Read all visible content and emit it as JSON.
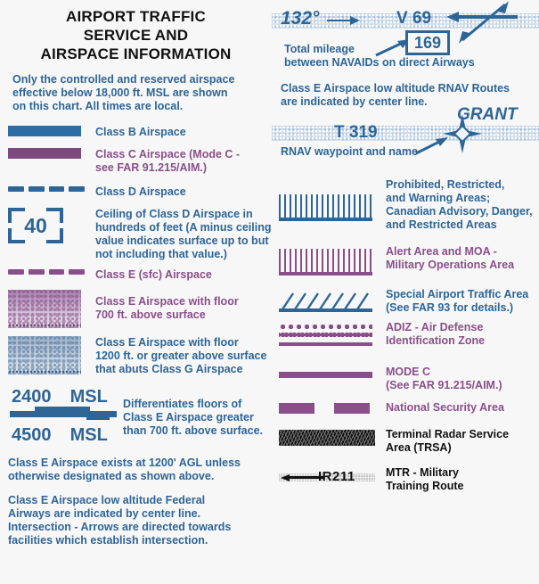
{
  "title": {
    "line1": "AIRPORT TRAFFIC",
    "line2": "SERVICE AND",
    "line3": "AIRSPACE INFORMATION"
  },
  "intro": {
    "line1": "Only the controlled and reserved airspace",
    "line2": "effective below 18,000 ft. MSL are shown",
    "line3": "on this chart.  All times are local."
  },
  "colors": {
    "blue": "#2d6597",
    "purple": "#8a4f8a",
    "class_b_swatch": "#2e6da4",
    "class_c_swatch": "#7d4a7d",
    "black": "#111111",
    "band": "#cfdcea",
    "background": "#f7f7f7"
  },
  "left_legend": [
    {
      "symbol": "solid-blue-bar",
      "label_lines": [
        "Class B Airspace"
      ],
      "color": "blue"
    },
    {
      "symbol": "solid-purple-bar",
      "label_lines": [
        "Class C Airspace (Mode C -",
        "see FAR 91.215/AIM.)"
      ],
      "color": "purple"
    },
    {
      "symbol": "blue-dashed-line",
      "label_lines": [
        "Class D Airspace"
      ],
      "color": "blue"
    },
    {
      "symbol": "bracketed-ceiling-value",
      "value": "40",
      "label_lines": [
        "Ceiling of Class D Airspace in",
        "hundreds of feet (A minus ceiling",
        "value indicates surface up to but",
        "not including that value.)"
      ],
      "color": "blue"
    },
    {
      "symbol": "purple-dashed-line",
      "label_lines": [
        "Class E (sfc) Airspace"
      ],
      "color": "purple"
    },
    {
      "symbol": "purple-gradient-band",
      "label_lines": [
        "Class E Airspace with floor",
        "700 ft. above surface"
      ],
      "color": "purple"
    },
    {
      "symbol": "blue-gradient-band",
      "label_lines": [
        "Class E Airspace with floor",
        "1200 ft. or greater above surface",
        "that abuts Class G Airspace"
      ],
      "color": "blue"
    }
  ],
  "msl_block": {
    "upper_value": "2400",
    "upper_unit": "MSL",
    "lower_value": "4500",
    "lower_unit": "MSL",
    "label_lines": [
      "Differentiates floors of",
      "Class E Airspace greater",
      "than 700 ft. above surface."
    ]
  },
  "left_paragraphs": [
    [
      "Class E Airspace exists at 1200' AGL unless",
      "otherwise designated as shown above."
    ],
    [
      "Class E Airspace low altitude Federal",
      "Airways are indicated by center line.",
      "Intersection - Arrows are directed towards",
      "facilities which establish intersection."
    ]
  ],
  "airway_diagram": {
    "bearing": "132°",
    "airway_id": "V 69",
    "mileage_box": "169",
    "caption_lines": [
      "Total mileage",
      "between NAVAIDs on direct Airways"
    ]
  },
  "rnav_section": {
    "intro_lines": [
      "Class E Airspace low altitude RNAV Routes",
      "are indicated by center line."
    ],
    "route_id": "T 319",
    "waypoint_name": "GRANT",
    "caption": "RNAV waypoint and name"
  },
  "right_legend": [
    {
      "symbol": "blue-comb-hatch",
      "label_lines": [
        "Prohibited, Restricted,",
        "and Warning Areas;",
        "Canadian Advisory, Danger,",
        "and Restricted Areas"
      ],
      "color": "blue"
    },
    {
      "symbol": "purple-comb-hatch",
      "label_lines": [
        "Alert Area and MOA -",
        "Military Operations Area"
      ],
      "color": "purple"
    },
    {
      "symbol": "blue-slash-hatch",
      "label_lines": [
        "Special Airport Traffic Area",
        "(See FAR 93 for details.)"
      ],
      "color": "blue"
    },
    {
      "symbol": "purple-dot-band",
      "label_lines": [
        "ADIZ - Air Defense",
        "Identification Zone"
      ],
      "color": "purple"
    },
    {
      "symbol": "solid-purple-line",
      "label_lines": [
        "MODE C",
        "(See FAR 91.215/AIM.)"
      ],
      "color": "purple"
    },
    {
      "symbol": "purple-dashes-pair",
      "label_lines": [
        "National Security Area"
      ],
      "color": "purple"
    },
    {
      "symbol": "black-textured-bar",
      "label_lines": [
        "Terminal Radar Service",
        "Area (TRSA)"
      ],
      "color": "black"
    },
    {
      "symbol": "mtr-arrow-route",
      "route_id": "IR211",
      "label_lines": [
        "MTR - Military",
        "Training Route"
      ],
      "color": "black"
    }
  ]
}
